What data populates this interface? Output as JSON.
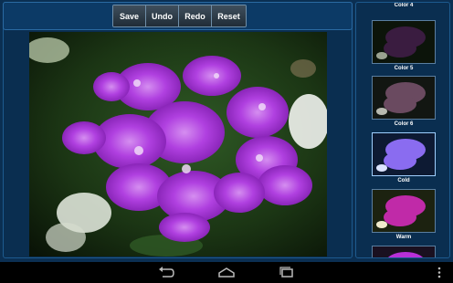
{
  "toolbar": {
    "save_label": "Save",
    "undo_label": "Undo",
    "redo_label": "Redo",
    "reset_label": "Reset"
  },
  "thumbnails": [
    {
      "label": "Color 4",
      "variant": "partial"
    },
    {
      "label": "Color 5",
      "variant": "dark"
    },
    {
      "label": "Color 6",
      "variant": "dark-muted"
    },
    {
      "label": "Cold",
      "variant": "cold"
    },
    {
      "label": "Warm",
      "variant": "warm"
    },
    {
      "label": "",
      "variant": "partial-bottom"
    }
  ],
  "navigation": {
    "icons": [
      "back-icon",
      "home-icon",
      "recent-apps-icon",
      "overflow-menu-icon"
    ]
  },
  "colors": {
    "app_background": "#0b2f52",
    "panel_border": "#1d5a8e",
    "flower": "#a530d6",
    "flower_light": "#c65be8",
    "leaves": "#244a1d"
  }
}
